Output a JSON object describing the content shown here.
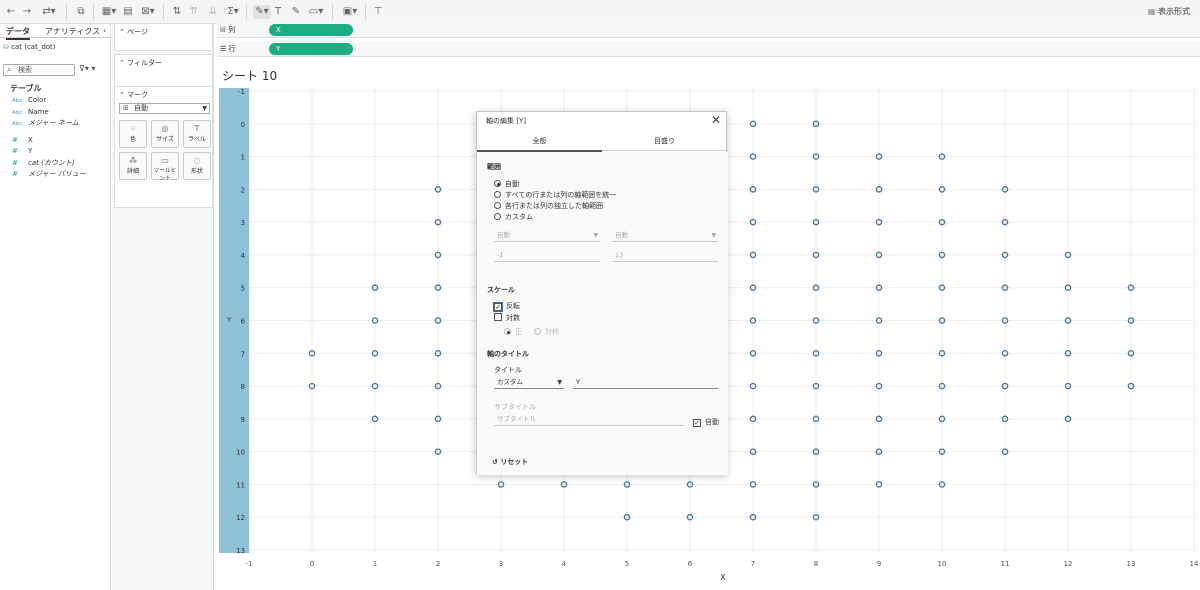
{
  "toolbar": {
    "show_me_label": "表示形式"
  },
  "left_pane": {
    "tab_data": "データ",
    "tab_analytics": "アナリティクス",
    "collapse": "‹",
    "datasource": "cat (cat_dot)",
    "search_placeholder": "検索",
    "tables_heading": "テーブル",
    "dimensions": [
      {
        "type": "Abc",
        "name": "Color"
      },
      {
        "type": "Abc",
        "name": "Name"
      },
      {
        "type": "Abc",
        "name": "メジャー ネーム"
      }
    ],
    "measures": [
      {
        "type": "#",
        "name": "X"
      },
      {
        "type": "#",
        "name": "Y"
      },
      {
        "type": "#",
        "name": "cat (カウント)"
      },
      {
        "type": "#",
        "name": "メジャー バリュー"
      }
    ]
  },
  "cards": {
    "pages": "ページ",
    "filters": "フィルター",
    "marks": "マーク",
    "mark_type": "自動",
    "mark_buttons": [
      "色",
      "サイズ",
      "ラベル",
      "詳細",
      "ツールヒント",
      "形状"
    ]
  },
  "shelves": {
    "columns_label": "列",
    "columns_pill": "X",
    "rows_label": "行",
    "rows_pill": "Y"
  },
  "sheet": {
    "title": "シート 10"
  },
  "chart_data": {
    "type": "scatter",
    "xlabel": "X",
    "ylabel": "Y",
    "xlim": [
      -1,
      14
    ],
    "ylim": [
      -1,
      13
    ],
    "y_reversed": true,
    "x_ticks": [
      -1,
      0,
      1,
      2,
      3,
      4,
      5,
      6,
      7,
      8,
      9,
      10,
      11,
      12,
      13,
      14
    ],
    "y_ticks": [
      -1,
      0,
      1,
      2,
      3,
      4,
      5,
      6,
      7,
      8,
      9,
      10,
      11,
      12,
      13
    ],
    "marker": "open-circle",
    "color": "#4e79a7",
    "points": [
      [
        7,
        0
      ],
      [
        8,
        0
      ],
      [
        7,
        1
      ],
      [
        8,
        1
      ],
      [
        9,
        1
      ],
      [
        10,
        1
      ],
      [
        2,
        2
      ],
      [
        7,
        2
      ],
      [
        8,
        2
      ],
      [
        9,
        2
      ],
      [
        10,
        2
      ],
      [
        11,
        2
      ],
      [
        2,
        3
      ],
      [
        7,
        3
      ],
      [
        8,
        3
      ],
      [
        9,
        3
      ],
      [
        10,
        3
      ],
      [
        11,
        3
      ],
      [
        2,
        4
      ],
      [
        7,
        4
      ],
      [
        8,
        4
      ],
      [
        9,
        4
      ],
      [
        10,
        4
      ],
      [
        11,
        4
      ],
      [
        12,
        4
      ],
      [
        1,
        5
      ],
      [
        2,
        5
      ],
      [
        7,
        5
      ],
      [
        8,
        5
      ],
      [
        9,
        5
      ],
      [
        10,
        5
      ],
      [
        11,
        5
      ],
      [
        12,
        5
      ],
      [
        13,
        5
      ],
      [
        1,
        6
      ],
      [
        2,
        6
      ],
      [
        7,
        6
      ],
      [
        8,
        6
      ],
      [
        9,
        6
      ],
      [
        10,
        6
      ],
      [
        11,
        6
      ],
      [
        12,
        6
      ],
      [
        13,
        6
      ],
      [
        0,
        7
      ],
      [
        1,
        7
      ],
      [
        2,
        7
      ],
      [
        7,
        7
      ],
      [
        8,
        7
      ],
      [
        9,
        7
      ],
      [
        10,
        7
      ],
      [
        11,
        7
      ],
      [
        12,
        7
      ],
      [
        13,
        7
      ],
      [
        0,
        8
      ],
      [
        1,
        8
      ],
      [
        2,
        8
      ],
      [
        7,
        8
      ],
      [
        8,
        8
      ],
      [
        9,
        8
      ],
      [
        10,
        8
      ],
      [
        11,
        8
      ],
      [
        12,
        8
      ],
      [
        13,
        8
      ],
      [
        1,
        9
      ],
      [
        2,
        9
      ],
      [
        7,
        9
      ],
      [
        8,
        9
      ],
      [
        9,
        9
      ],
      [
        10,
        9
      ],
      [
        11,
        9
      ],
      [
        12,
        9
      ],
      [
        2,
        10
      ],
      [
        7,
        10
      ],
      [
        8,
        10
      ],
      [
        9,
        10
      ],
      [
        10,
        10
      ],
      [
        11,
        10
      ],
      [
        3,
        11
      ],
      [
        4,
        11
      ],
      [
        5,
        11
      ],
      [
        6,
        11
      ],
      [
        7,
        11
      ],
      [
        8,
        11
      ],
      [
        9,
        11
      ],
      [
        10,
        11
      ],
      [
        5,
        12
      ],
      [
        6,
        12
      ],
      [
        7,
        12
      ],
      [
        8,
        12
      ]
    ]
  },
  "dialog": {
    "title": "軸の編集 [Y]",
    "close": "✕",
    "tab_general": "全般",
    "tab_ticks": "目盛り",
    "range_heading": "範囲",
    "range_options": [
      "自動",
      "すべての行または列の軸範囲を統一",
      "各行または列の独立した軸範囲",
      "カスタム"
    ],
    "range_selected": 0,
    "range_start_dropdown": "自動",
    "range_end_dropdown": "自動",
    "range_start_value": "-1",
    "range_end_value": "13",
    "scale_heading": "スケール",
    "reversed_label": "反転",
    "reversed_checked": true,
    "log_label": "対数",
    "log_checked": false,
    "positive_label": "正",
    "symmetric_label": "対称",
    "axis_title_heading": "軸のタイトル",
    "title_label": "タイトル",
    "title_mode": "カスタム",
    "title_value": "Y",
    "subtitle_label": "サブタイトル",
    "subtitle_placeholder": "サブタイトル",
    "auto_label": "自動",
    "auto_checked": true,
    "reset_label": "リセット"
  }
}
